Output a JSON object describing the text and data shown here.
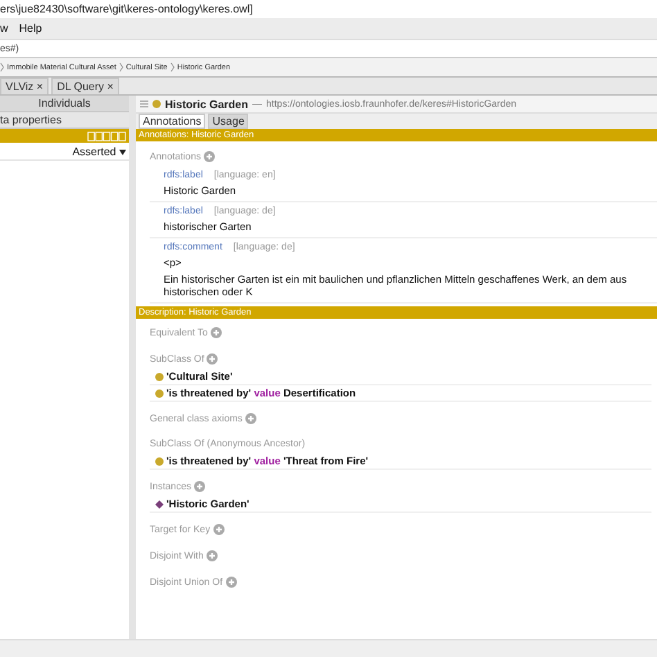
{
  "window": {
    "title": "ers\\jue82430\\software\\git\\keres-ontology\\keres.owl]"
  },
  "menu": [
    "w",
    "Help"
  ],
  "address": "es#)",
  "breadcrumb": [
    "Immobile Material Cultural Asset",
    "Cultural Site",
    "Historic Garden"
  ],
  "tabs": [
    {
      "label": "VLViz",
      "close": "×"
    },
    {
      "label": "DL Query",
      "close": "×"
    }
  ],
  "left": {
    "tabs": [
      "Individuals",
      "ta properties"
    ],
    "mode": "Asserted"
  },
  "entity": {
    "name": "Historic Garden",
    "dash": "—",
    "iri": "https://ontologies.iosb.fraunhofer.de/keres#HistoricGarden",
    "tabs": [
      {
        "label": "Annotations",
        "selected": true
      },
      {
        "label": "Usage",
        "selected": false
      }
    ]
  },
  "annotations": {
    "header": "Annotations: Historic Garden",
    "title": "Annotations",
    "items": [
      {
        "property": "rdfs:label",
        "language": "[language: en]",
        "lines": [
          "Historic Garden"
        ]
      },
      {
        "property": "rdfs:label",
        "language": "[language: de]",
        "lines": [
          "historischer Garten"
        ]
      },
      {
        "property": "rdfs:comment",
        "language": "[language: de]",
        "lines": [
          "<p>",
          "Ein historischer Garten ist ein mit baulichen und pflanzlichen Mitteln geschaffenes Werk, an dem aus historischen oder K"
        ]
      }
    ]
  },
  "description": {
    "header": "Description: Historic Garden",
    "sections": [
      {
        "title": "Equivalent To"
      },
      {
        "title": "SubClass Of",
        "items": [
          {
            "kind": "class",
            "parts": [
              {
                "kind": "name",
                "text": "'Cultural Site'"
              }
            ]
          },
          {
            "kind": "class",
            "parts": [
              {
                "kind": "name",
                "text": "'is threatened by'"
              },
              {
                "kind": "keyword",
                "text": "value"
              },
              {
                "kind": "name",
                "text": "Desertification"
              }
            ]
          }
        ]
      },
      {
        "title": "General class axioms"
      },
      {
        "title": "SubClass Of (Anonymous Ancestor)",
        "plain": true,
        "items": [
          {
            "kind": "class",
            "parts": [
              {
                "kind": "name",
                "text": "'is threatened by'"
              },
              {
                "kind": "keyword",
                "text": "value"
              },
              {
                "kind": "name",
                "text": "'Threat from Fire'"
              }
            ]
          }
        ]
      },
      {
        "title": "Instances",
        "items": [
          {
            "kind": "individual",
            "parts": [
              {
                "kind": "name",
                "text": "'Historic Garden'"
              }
            ]
          }
        ]
      },
      {
        "title": "Target for Key"
      },
      {
        "title": "Disjoint With"
      },
      {
        "title": "Disjoint Union Of"
      }
    ]
  }
}
